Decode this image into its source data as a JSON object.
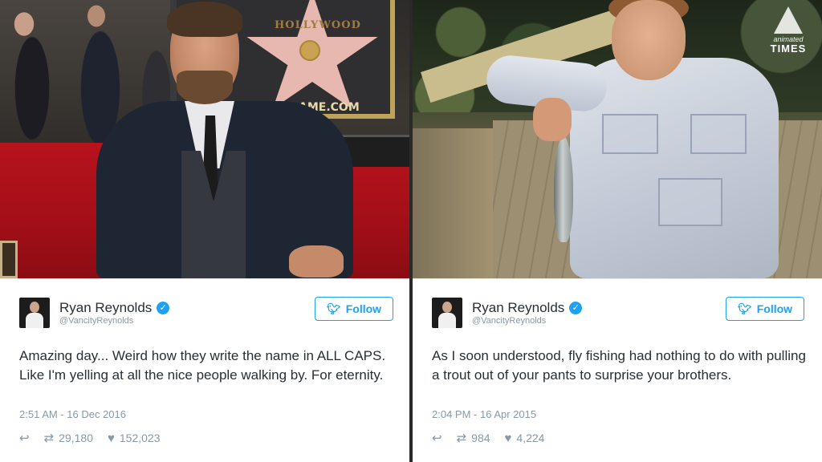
{
  "left_photo": {
    "star_text": "HOLLYWOOD",
    "fame_text": "AME.COM"
  },
  "logo": {
    "small": "animated",
    "big": "TIMES"
  },
  "tweets": [
    {
      "name": "Ryan Reynolds",
      "handle": "@VancityReynolds",
      "follow_label": "Follow",
      "text": "Amazing day... Weird how they write the name in ALL CAPS. Like I'm yelling at all the nice people walking by. For eternity.",
      "timestamp": "2:51 AM - 16 Dec 2016",
      "retweets": "29,180",
      "likes": "152,023"
    },
    {
      "name": "Ryan Reynolds",
      "handle": "@VancityReynolds",
      "follow_label": "Follow",
      "text": "As I soon understood, fly fishing had nothing to do with pulling a trout out of your pants to surprise your brothers.",
      "timestamp": "2:04 PM - 16 Apr 2015",
      "retweets": "984",
      "likes": "4,224"
    }
  ],
  "colors": {
    "twitter_blue": "#1da1f2",
    "text_dark": "#292f33",
    "text_muted": "#8899a6"
  },
  "icons": {
    "verified": "verified-badge-icon",
    "bird": "twitter-bird-icon",
    "reply": "reply-icon",
    "retweet": "retweet-icon",
    "like": "heart-icon"
  }
}
